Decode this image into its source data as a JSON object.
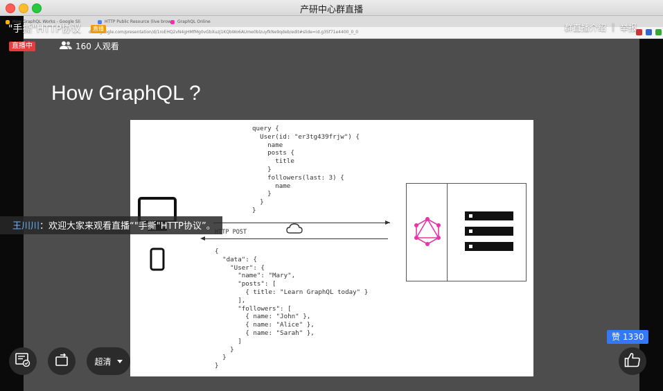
{
  "window": {
    "title": "产研中心群直播"
  },
  "browser": {
    "tabs": [
      "How GraphQL Works - Google Sli",
      "HTTP Public Resource (live brow",
      "GraphQL Online"
    ],
    "url": "docs.google.com/presentation/d/1roEHQ2vN4gHMfMg0vGbXuzJ1KQbWo6AUme0blzuyfkNe9qdeb/edit#slide=id.g35f71e4400_0_0"
  },
  "stream": {
    "title": "\"手撕\"HTTP协议",
    "tag": "直播",
    "links": {
      "intro": "群直播介绍",
      "separator": "|",
      "report": "举报"
    },
    "live_badge": "直播中",
    "viewers": "160 人观看"
  },
  "slide": {
    "heading": "How GraphQL ?",
    "query": "query {\n  User(id: \"er3tg439frjw\") {\n    name\n    posts {\n      title\n    }\n    followers(last: 3) {\n      name\n    }\n  }\n}",
    "http_label": "HTTP POST",
    "response": "{\n  \"data\": {\n    \"User\": {\n      \"name\": \"Mary\",\n      \"posts\": [\n        { title: \"Learn GraphQL today\" }\n      ],\n      \"followers\": [\n        { name: \"John\" },\n        { name: \"Alice\" },\n        { name: \"Sarah\" },\n      ]\n    }\n  }\n}"
  },
  "comment": {
    "user": "王川川",
    "separator": "：",
    "text": "欢迎大家来观看直播“\"手撕\"HTTP协议”。"
  },
  "controls": {
    "quality": "超清"
  },
  "likes": {
    "label": "赞 1330"
  },
  "colors": {
    "live": "#e83b3b",
    "accent": "#3478f6",
    "graphql": "#e535ab"
  }
}
